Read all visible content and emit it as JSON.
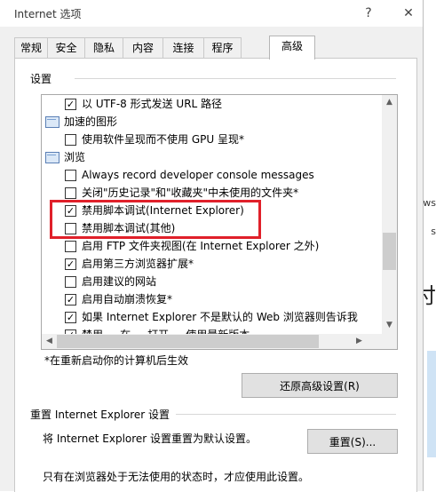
{
  "background": {
    "fragment_1": "ws",
    "fragment_2": "s",
    "fragment_3": "付"
  },
  "window": {
    "title": "Internet 选项",
    "help_label": "?",
    "close_label": "✕"
  },
  "tabs": [
    {
      "label": "常规"
    },
    {
      "label": "安全"
    },
    {
      "label": "隐私"
    },
    {
      "label": "内容"
    },
    {
      "label": "连接"
    },
    {
      "label": "程序"
    },
    {
      "label": "高级"
    }
  ],
  "settings": {
    "label": "设置",
    "items": [
      {
        "type": "checkbox",
        "checked": true,
        "label": "以 UTF-8 形式发送 URL 路径"
      },
      {
        "type": "group",
        "label": "加速的图形"
      },
      {
        "type": "checkbox",
        "checked": false,
        "label": "使用软件呈现而不使用 GPU 呈现*"
      },
      {
        "type": "group",
        "label": "浏览"
      },
      {
        "type": "checkbox",
        "checked": false,
        "label": "Always record developer console messages"
      },
      {
        "type": "checkbox",
        "checked": false,
        "label": "关闭\"历史记录\"和\"收藏夹\"中未使用的文件夹*"
      },
      {
        "type": "checkbox",
        "checked": true,
        "label": "禁用脚本调试(Internet Explorer)"
      },
      {
        "type": "checkbox",
        "checked": false,
        "label": "禁用脚本调试(其他)"
      },
      {
        "type": "checkbox",
        "checked": false,
        "label": "启用 FTP 文件夹视图(在 Internet Explorer 之外)"
      },
      {
        "type": "checkbox",
        "checked": true,
        "label": "启用第三方浏览器扩展*"
      },
      {
        "type": "checkbox",
        "checked": false,
        "label": "启用建议的网站"
      },
      {
        "type": "checkbox",
        "checked": true,
        "label": "启用自动崩溃恢复*"
      },
      {
        "type": "checkbox",
        "checked": true,
        "label": "如果 Internet Explorer 不是默认的 Web 浏览器则告诉我"
      },
      {
        "type": "checkbox",
        "checked": true,
        "label": "禁用 ... 在 ... 打开 ... 使用最新版本"
      }
    ],
    "restart_note": "*在重新启动你的计算机后生效",
    "restore_button": "还原高级设置(R)"
  },
  "reset": {
    "label": "重置 Internet Explorer 设置",
    "description": "将 Internet Explorer 设置重置为默认设置。",
    "button": "重置(S)...",
    "note": "只有在浏览器处于无法使用的状态时，才应使用此设置。"
  },
  "colors": {
    "highlight_border": "#e0202a",
    "dialog_bg": "#f0f0f0"
  }
}
